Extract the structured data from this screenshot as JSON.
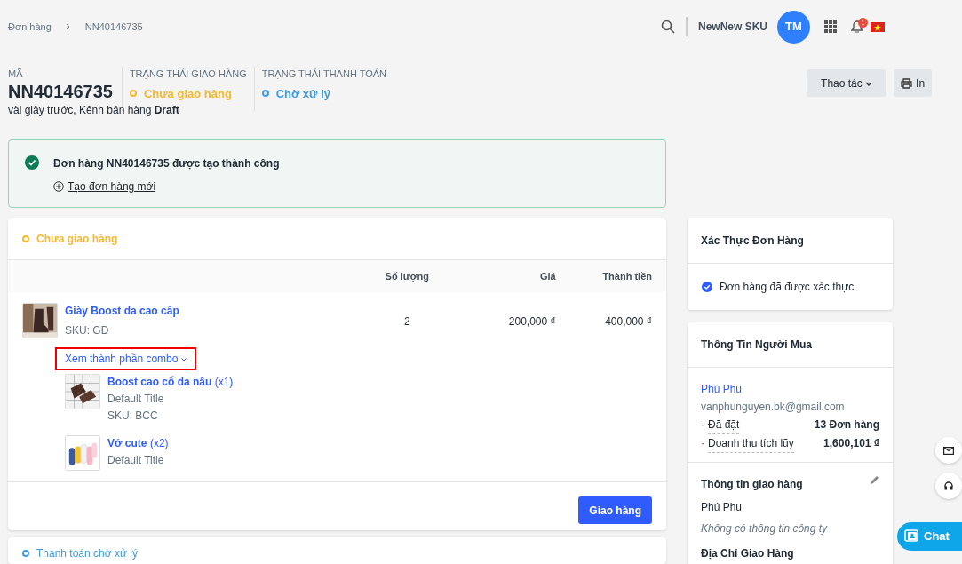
{
  "breadcrumb": [
    {
      "label": "Đơn hàng"
    },
    {
      "label": "NN40146735"
    }
  ],
  "topbar": {
    "store": "NewNew SKU",
    "avatar": "TM",
    "notifications": "1"
  },
  "order": {
    "code_label": "MÃ",
    "code": "NN40146735",
    "statuses": [
      {
        "label": "TRẠNG THÁI GIAO HÀNG",
        "value": "Chưa giao hàng",
        "color": "#f5b82e"
      },
      {
        "label": "TRẠNG THÁI THANH TOÁN",
        "value": "Chờ xử lý",
        "color": "#3d9be9"
      }
    ],
    "meta": "vài giây trước, Kênh bán hàng **Draft**"
  },
  "actions": [
    {
      "label": "Thao tác",
      "kind": "dropdown"
    },
    {
      "label": "In",
      "kind": "print"
    }
  ],
  "alert": {
    "message": "Đơn hàng NN40146735 được tạo thành công",
    "link": "Tạo đơn hàng mới"
  },
  "fulfillment": {
    "status": "Chưa giao hàng",
    "color": "#f5b82e",
    "columns": [
      "Số lượng",
      "Giá",
      "Thành tiền"
    ],
    "item": {
      "name": "Giày Boost da cao cấp",
      "sku": "SKU: GD",
      "quantity": "2",
      "price": "200,000 ₫",
      "total": "400,000 ₫",
      "combo_toggle": "Xem thành phần combo",
      "highlighted": true,
      "components": [
        {
          "name": "Boost cao cổ da nâu",
          "qty": "(x1)",
          "variant": "Default Title",
          "sku": "SKU: BCC"
        },
        {
          "name": "Vớ cute",
          "qty": "(x2)",
          "variant": "Default Title"
        }
      ]
    },
    "button": "Giao hàng"
  },
  "payment": {
    "status": "Thanh toán chờ xử lý",
    "color": "#3d9be9"
  },
  "verification": {
    "title": "Xác Thực Đơn Hàng",
    "text": "Đơn hàng đã được xác thực"
  },
  "buyer": {
    "title": "Thông Tin Người Mua",
    "name": "Phú Phu",
    "email": "vanphunguyen.bk@gmail.com",
    "stats": [
      {
        "bullet": "·",
        "label": "Đã đặt",
        "value": "13 Đơn hàng"
      },
      {
        "bullet": "·",
        "label": "Doanh thu tích lũy",
        "value": "1,600,101 ₫"
      }
    ],
    "shipping_title": "Thông tin giao hàng",
    "shipping_name": "Phú Phu",
    "company": "Không có thông tin công ty",
    "address_title": "Địa Chỉ Giao Hàng"
  },
  "chat": {
    "label": "Chat"
  }
}
